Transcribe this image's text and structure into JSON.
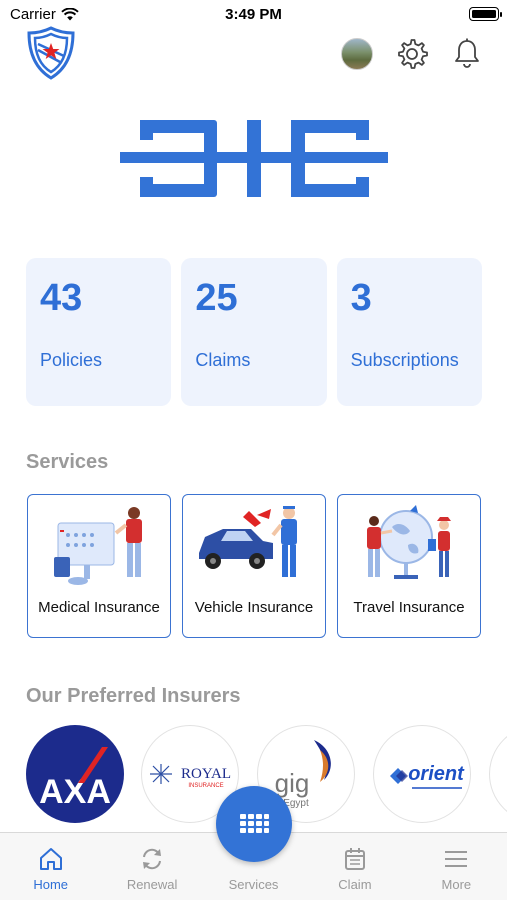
{
  "status_bar": {
    "carrier": "Carrier",
    "time": "3:49 PM"
  },
  "header": {
    "shield_logo_icon": "shield-star-icon",
    "avatar_icon": "avatar",
    "settings_icon": "gear-icon",
    "notifications_icon": "bell-icon",
    "brand_text": "BIB"
  },
  "stats": [
    {
      "value": "43",
      "label": "Policies"
    },
    {
      "value": "25",
      "label": "Claims"
    },
    {
      "value": "3",
      "label": "Subscriptions"
    }
  ],
  "services": {
    "title": "Services",
    "items": [
      {
        "label": "Medical Insurance",
        "icon": "medical-illustration"
      },
      {
        "label": "Vehicle Insurance",
        "icon": "vehicle-illustration"
      },
      {
        "label": "Travel Insurance",
        "icon": "travel-illustration"
      }
    ]
  },
  "insurers": {
    "title": "Our Preferred Insurers",
    "items": [
      {
        "name": "AXA"
      },
      {
        "name": "ROYAL",
        "sub": "INSURANCE"
      },
      {
        "name": "gig",
        "sub": "Egypt"
      },
      {
        "name": "orient"
      }
    ]
  },
  "tab_bar": {
    "items": [
      {
        "label": "Home",
        "icon": "home-icon",
        "active": true
      },
      {
        "label": "Renewal",
        "icon": "refresh-icon"
      },
      {
        "label": "Services",
        "icon": "grid-icon"
      },
      {
        "label": "Claim",
        "icon": "calendar-icon"
      },
      {
        "label": "More",
        "icon": "menu-icon"
      }
    ]
  },
  "colors": {
    "primary": "#2f6fd6",
    "card_bg": "#eef3fd",
    "muted": "#9a9a9a"
  }
}
